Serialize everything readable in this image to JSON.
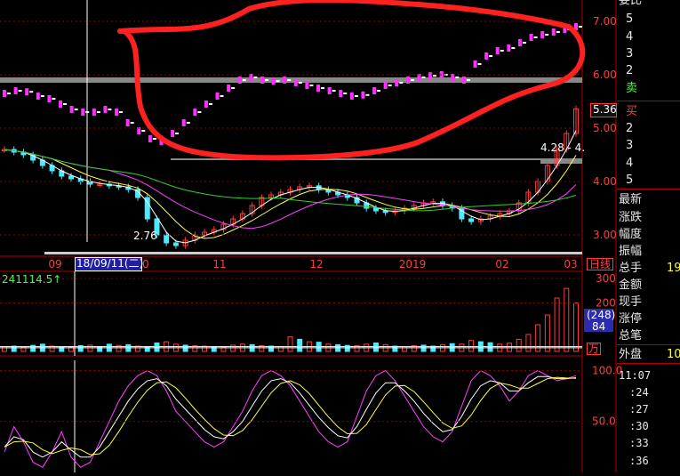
{
  "colors": {
    "background": "#000000",
    "up_candle": "#ff3c3c",
    "down_candle": "#4ee8ff",
    "ma5": "#ffffff",
    "ma10": "#ffff40",
    "ma20": "#ff40ff",
    "ma60": "#30d030",
    "annotation_red": "#ff2020",
    "grid": "#8a0000",
    "axis_text": "#ff3c3c",
    "lower_band": "#ff30ff"
  },
  "chart_data": [
    {
      "type": "candlestick",
      "name_hint": "price",
      "yaxis_ticks": [
        "7.00",
        "6.00",
        "5.00",
        "4.00",
        "3.00"
      ],
      "ylim": [
        2.6,
        7.4
      ],
      "xaxis_ticks": [
        "09",
        "10",
        "11",
        "12",
        "2019",
        "02",
        "03"
      ],
      "current_price_label": "5.36",
      "low_label": "2.76",
      "high_label": "4.28 - 4.",
      "cursor_date": "18/09/11(二)",
      "period_label": "日线",
      "close_series": [
        4.6,
        4.55,
        4.5,
        4.4,
        4.3,
        4.2,
        4.1,
        4.05,
        4.0,
        3.95,
        3.95,
        3.92,
        3.9,
        3.85,
        3.7,
        3.3,
        3.0,
        2.85,
        2.8,
        2.9,
        3.0,
        3.05,
        3.1,
        3.2,
        3.3,
        3.4,
        3.55,
        3.7,
        3.75,
        3.8,
        3.85,
        3.9,
        3.92,
        3.85,
        3.8,
        3.75,
        3.7,
        3.6,
        3.5,
        3.45,
        3.42,
        3.45,
        3.5,
        3.55,
        3.6,
        3.62,
        3.55,
        3.5,
        3.3,
        3.25,
        3.3,
        3.35,
        3.4,
        3.45,
        3.6,
        3.8,
        4.0,
        4.3,
        4.6,
        4.9,
        5.36
      ],
      "upper_band_series": [
        5.65,
        5.7,
        5.68,
        5.6,
        5.55,
        5.45,
        5.35,
        5.3,
        5.3,
        5.35,
        5.3,
        5.1,
        4.95,
        4.8,
        4.75,
        4.9,
        5.1,
        5.3,
        5.45,
        5.6,
        5.75,
        5.9,
        5.95,
        5.9,
        5.88,
        5.9,
        5.85,
        5.8,
        5.75,
        5.7,
        5.65,
        5.6,
        5.62,
        5.7,
        5.8,
        5.85,
        5.9,
        5.95,
        5.98,
        6.0,
        5.95,
        5.9,
        6.2,
        6.35,
        6.45,
        6.5,
        6.6,
        6.7,
        6.75,
        6.8,
        6.85,
        6.9
      ]
    },
    {
      "type": "bar",
      "name_hint": "volume",
      "header_value": "241114.5↑",
      "yaxis_ticks": [
        "300",
        "200"
      ],
      "ylim": [
        0,
        330
      ],
      "box_values": [
        "(248)",
        "84"
      ],
      "unit_label": "万",
      "values": [
        20,
        22,
        18,
        25,
        30,
        22,
        20,
        18,
        24,
        26,
        20,
        30,
        25,
        28,
        22,
        20,
        35,
        40,
        30,
        26,
        24,
        22,
        20,
        18,
        26,
        30,
        28,
        24,
        22,
        20,
        60,
        50,
        40,
        38,
        30,
        28,
        25,
        24,
        30,
        35,
        28,
        22,
        20,
        24,
        26,
        22,
        28,
        32,
        30,
        45,
        40,
        36,
        30,
        34,
        50,
        70,
        110,
        150,
        220,
        260,
        200
      ],
      "up_flags": [
        1,
        0,
        1,
        0,
        0,
        1,
        0,
        1,
        0,
        1,
        0,
        0,
        1,
        0,
        1,
        0,
        0,
        1,
        1,
        0,
        1,
        1,
        0,
        1,
        1,
        1,
        0,
        1,
        0,
        1,
        1,
        0,
        1,
        0,
        1,
        0,
        0,
        1,
        1,
        0,
        1,
        0,
        1,
        1,
        0,
        0,
        1,
        0,
        1,
        1,
        0,
        0,
        1,
        1,
        1,
        1,
        1,
        1,
        1,
        1,
        1
      ]
    },
    {
      "type": "line",
      "name_hint": "oscillator",
      "yaxis_ticks": [
        "100.0",
        "50.0"
      ],
      "ylim": [
        0,
        110
      ],
      "series": [
        {
          "values": [
            20,
            45,
            30,
            10,
            5,
            20,
            40,
            15,
            5,
            10,
            30,
            50,
            70,
            85,
            95,
            100,
            95,
            80,
            60,
            50,
            40,
            30,
            25,
            30,
            45,
            60,
            80,
            95,
            100,
            95,
            85,
            70,
            55,
            40,
            30,
            25,
            30,
            55,
            80,
            95,
            100,
            90,
            75,
            60,
            45,
            35,
            30,
            40,
            65,
            90,
            100,
            95,
            85,
            70,
            80,
            95,
            100,
            95,
            90,
            92,
            95
          ]
        },
        {
          "values": [
            25,
            35,
            32,
            20,
            15,
            20,
            30,
            22,
            15,
            15,
            25,
            40,
            55,
            70,
            82,
            90,
            92,
            85,
            72,
            62,
            52,
            42,
            35,
            33,
            40,
            50,
            65,
            80,
            90,
            92,
            88,
            78,
            66,
            54,
            44,
            36,
            34,
            45,
            62,
            78,
            88,
            88,
            80,
            70,
            58,
            48,
            40,
            42,
            55,
            72,
            85,
            90,
            88,
            80,
            80,
            88,
            94,
            94,
            92,
            92,
            93
          ]
        }
      ]
    }
  ],
  "sidebar": {
    "top_label": "委比",
    "sell_rows": [
      "5",
      "4",
      "3",
      "2"
    ],
    "sell_label": "卖",
    "buy_label": "买",
    "buy_rows": [
      "2",
      "3",
      "4",
      "5"
    ],
    "stats": [
      {
        "label": "最新",
        "value": ""
      },
      {
        "label": "涨跌",
        "value": ""
      },
      {
        "label": "幅度",
        "value": ""
      },
      {
        "label": "振幅",
        "value": ""
      },
      {
        "label": "总手",
        "value": "19"
      },
      {
        "label": "金额",
        "value": ""
      },
      {
        "label": "现手",
        "value": ""
      },
      {
        "label": "涨停",
        "value": ""
      },
      {
        "label": "总笔",
        "value": ""
      }
    ],
    "outer_label": "外盘",
    "outer_value": "10",
    "times": [
      "11:07",
      ":24",
      ":27",
      ":30",
      ":33",
      ":36"
    ]
  },
  "annotation": {
    "shape": "hand-drawn ellipse"
  }
}
